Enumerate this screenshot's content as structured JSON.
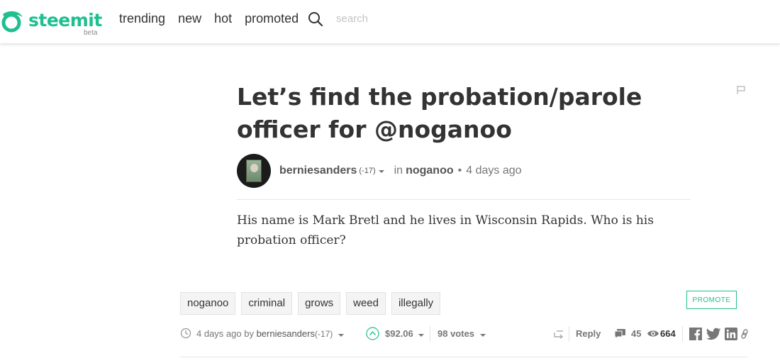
{
  "header": {
    "logo_text": "steemit",
    "logo_beta": "beta",
    "brand_color": "#1fbf8f",
    "nav": [
      "trending",
      "new",
      "hot",
      "promoted"
    ],
    "search_placeholder": "search"
  },
  "post": {
    "title": "Let’s find the probation/parole officer for @noganoo",
    "author": "berniesanders",
    "author_rep": "(-17)",
    "in_label": "in",
    "category": "noganoo",
    "bullet": "•",
    "time": "4 days ago",
    "body": "His name is Mark Bretl and he lives in Wisconsin Rapids.  Who is his probation officer?"
  },
  "tags": [
    "noganoo",
    "criminal",
    "grows",
    "weed",
    "illegally"
  ],
  "promote_label": "PROMOTE",
  "footer": {
    "time_prefix": "4 days ago by",
    "author": "berniesanders",
    "author_rep": "(-17)",
    "payout": "$92.06",
    "votes": "98 votes",
    "reply": "Reply",
    "comments": "45",
    "views": "664"
  },
  "icons": {
    "logo": "steemit-logo-icon",
    "search": "search-icon",
    "flag": "flag-icon",
    "clock": "clock-icon",
    "upvote": "upvote-icon",
    "reblog": "reblog-icon",
    "comments": "comments-icon",
    "views": "eye-icon",
    "facebook": "facebook-icon",
    "twitter": "twitter-icon",
    "linkedin": "linkedin-icon",
    "link": "link-icon"
  }
}
